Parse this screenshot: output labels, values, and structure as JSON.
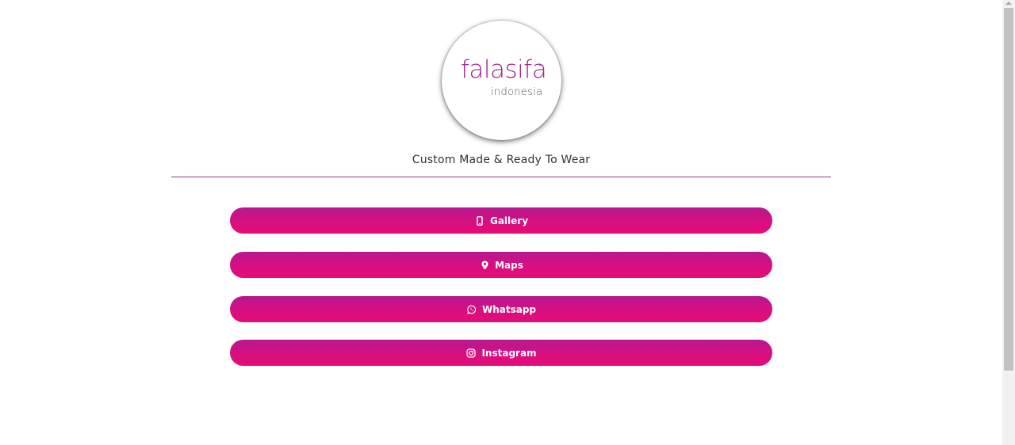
{
  "logo": {
    "brand": "falasifa",
    "trademark": "™",
    "subtitle": "indonesia",
    "brand_color": "#a0268c"
  },
  "tagline": "Custom Made & Ready To Wear",
  "colors": {
    "divider": "#8e3a80",
    "button_top": "#b5198f",
    "button_bottom": "#e60b78",
    "button_text": "#ffffff"
  },
  "links": [
    {
      "label": "Gallery",
      "icon": "mobile-phone-icon"
    },
    {
      "label": "Maps",
      "icon": "map-marker-icon"
    },
    {
      "label": "Whatsapp",
      "icon": "whatsapp-icon"
    },
    {
      "label": "Instagram",
      "icon": "instagram-icon"
    }
  ]
}
